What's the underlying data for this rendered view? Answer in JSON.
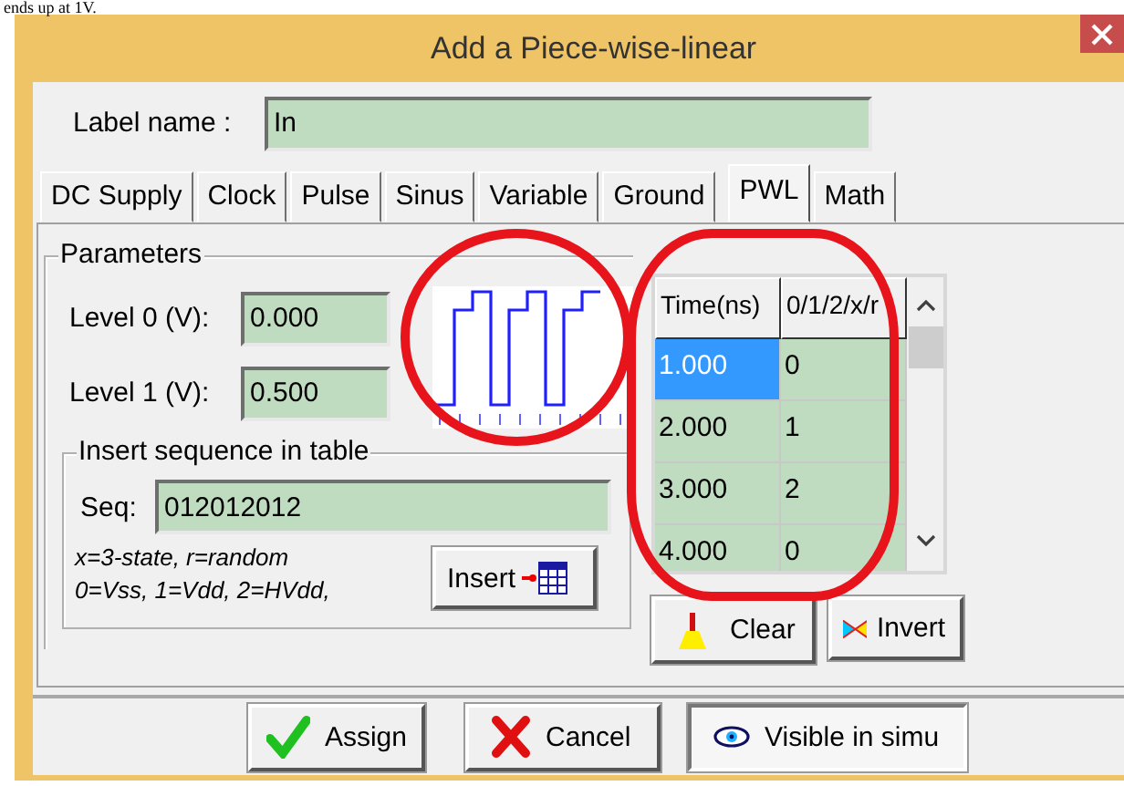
{
  "caption_fragment": "ends up at 1V.",
  "window": {
    "title": "Add a Piece-wise-linear"
  },
  "label_name": {
    "label": "Label name :",
    "value": "In"
  },
  "tabs": [
    {
      "label": "DC Supply",
      "selected": false
    },
    {
      "label": "Clock",
      "selected": false
    },
    {
      "label": "Pulse",
      "selected": false
    },
    {
      "label": "Sinus",
      "selected": false
    },
    {
      "label": "Variable",
      "selected": false
    },
    {
      "label": "Ground",
      "selected": false
    },
    {
      "label": "PWL",
      "selected": true
    },
    {
      "label": "Math",
      "selected": false
    }
  ],
  "parameters": {
    "title": "Parameters",
    "levels": [
      {
        "label": "Level 0 (V):",
        "value": "0.000"
      },
      {
        "label": "Level 1 (V):",
        "value": "0.500"
      }
    ]
  },
  "insert_sequence": {
    "title": "Insert sequence in table",
    "seq_label": "Seq:",
    "value": "012012012",
    "hints": [
      "x=3-state, r=random",
      "0=Vss, 1=Vdd, 2=HVdd,"
    ],
    "button": "Insert"
  },
  "table": {
    "columns": [
      "Time(ns)",
      "0/1/2/x/r"
    ],
    "rows": [
      {
        "cells": [
          "1.000",
          "0"
        ],
        "selected": true
      },
      {
        "cells": [
          "2.000",
          "1"
        ],
        "selected": false
      },
      {
        "cells": [
          "3.000",
          "2"
        ],
        "selected": false
      },
      {
        "cells": [
          "4.000",
          "0"
        ],
        "selected": false
      }
    ]
  },
  "table_buttons": [
    {
      "label": "Clear",
      "kind": "clear"
    },
    {
      "label": "Invert",
      "kind": "invert"
    }
  ],
  "buttons": [
    {
      "label": "Assign",
      "kind": "assign",
      "pressed": false
    },
    {
      "label": "Cancel",
      "kind": "cancel",
      "pressed": false
    },
    {
      "label": "Visible in simu",
      "kind": "visible",
      "pressed": true
    }
  ],
  "annotations": [
    {
      "kind": "ellipse",
      "color": "#e8141c"
    },
    {
      "kind": "ellipse",
      "color": "#e8141c"
    }
  ]
}
